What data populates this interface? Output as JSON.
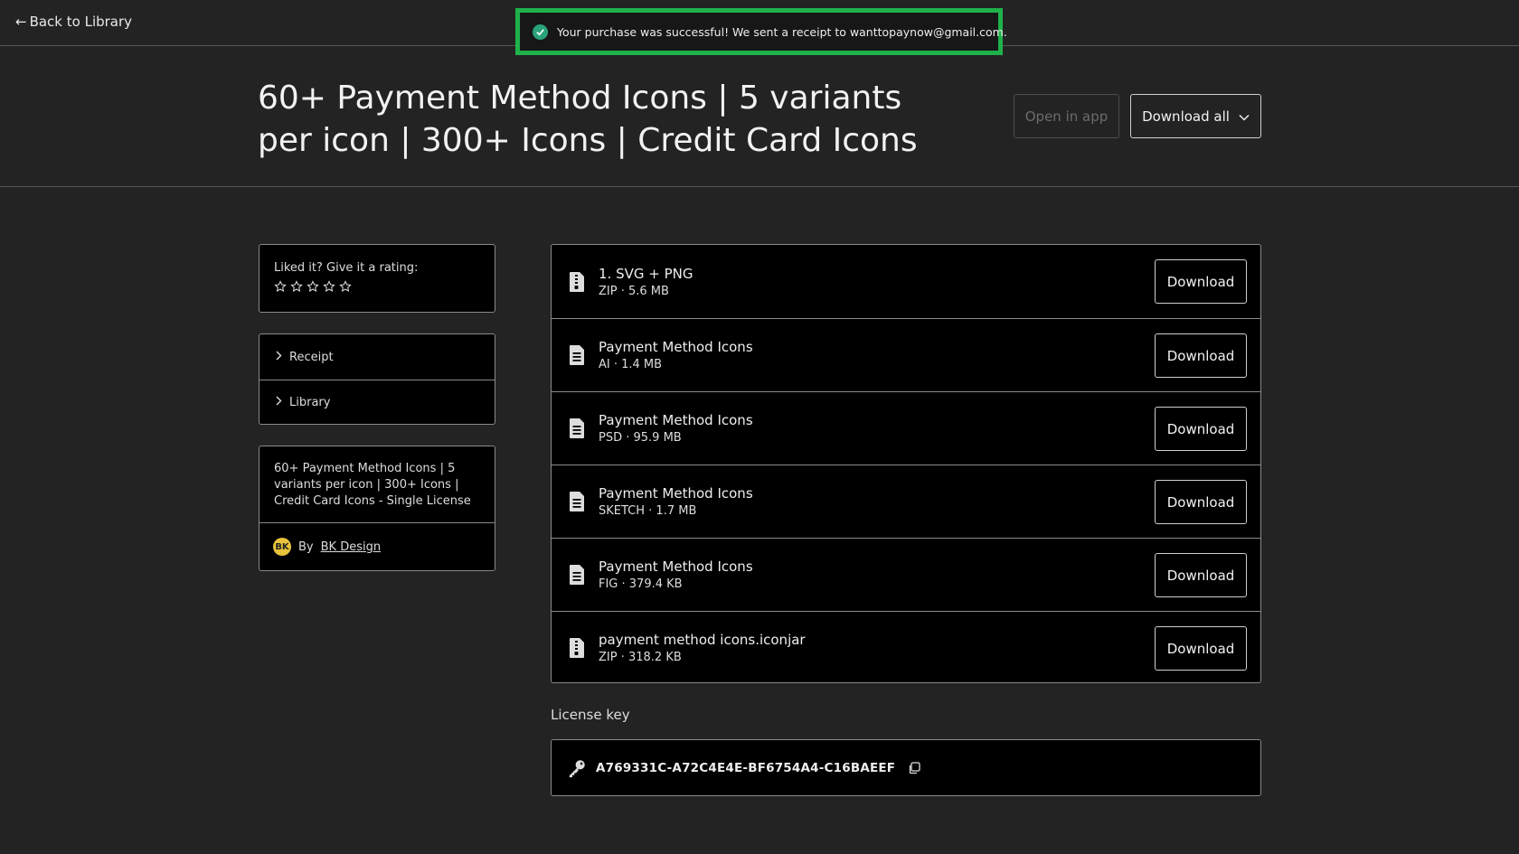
{
  "nav": {
    "back_label": "Back to Library"
  },
  "toast": {
    "message": "Your purchase was successful! We sent a receipt to wanttopaynow@gmail.com.",
    "color": "#1fb14b"
  },
  "header": {
    "title": "60+ Payment Method Icons | 5 variants per icon | 300+ Icons | Credit Card Icons",
    "open_in_app_label": "Open in app",
    "download_all_label": "Download all"
  },
  "rating": {
    "label": "Liked it? Give it a rating:",
    "stars_total": 5,
    "stars_filled": 0
  },
  "side_nav": {
    "items": [
      {
        "label": "Receipt"
      },
      {
        "label": "Library"
      }
    ]
  },
  "product": {
    "name": "60+ Payment Method Icons | 5 variants per icon | 300+ Icons | Credit Card Icons - Single License",
    "by_label": "By",
    "creator_name": "BK Design",
    "creator_initials": "BK"
  },
  "files": [
    {
      "name": "1. SVG + PNG",
      "meta": "ZIP · 5.6 MB",
      "button_label": "Download",
      "icon": "zip-file-icon"
    },
    {
      "name": "Payment Method Icons",
      "meta": "AI · 1.4 MB",
      "button_label": "Download",
      "icon": "document-icon"
    },
    {
      "name": "Payment Method Icons",
      "meta": "PSD · 95.9 MB",
      "button_label": "Download",
      "icon": "document-icon"
    },
    {
      "name": "Payment Method Icons",
      "meta": "SKETCH · 1.7 MB",
      "button_label": "Download",
      "icon": "document-icon"
    },
    {
      "name": "Payment Method Icons",
      "meta": "FIG · 379.4 KB",
      "button_label": "Download",
      "icon": "document-icon"
    },
    {
      "name": "payment method icons.iconjar",
      "meta": "ZIP · 318.2 KB",
      "button_label": "Download",
      "icon": "zip-file-icon"
    }
  ],
  "license": {
    "label": "License key",
    "value": "A769331C-A72C4E4E-BF6754A4-C16BAEEF"
  }
}
